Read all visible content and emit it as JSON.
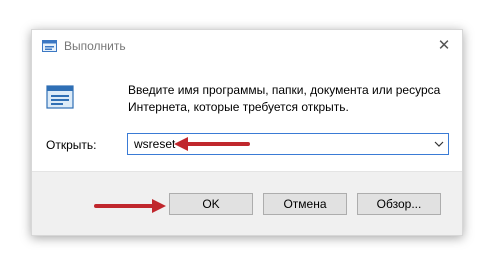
{
  "window": {
    "title": "Выполнить",
    "description": "Введите имя программы, папки, документа или ресурса Интернета, которые требуется открыть.",
    "close_symbol": "✕"
  },
  "open_field": {
    "label": "Открыть:",
    "value": "wsreset"
  },
  "buttons": {
    "ok": "OK",
    "cancel": "Отмена",
    "browse": "Обзор..."
  },
  "icons": {
    "run": "run-dialog-icon",
    "close": "close-icon",
    "chevron": "chevron-down-icon"
  },
  "annotations": {
    "arrow_color": "#c0272d"
  }
}
